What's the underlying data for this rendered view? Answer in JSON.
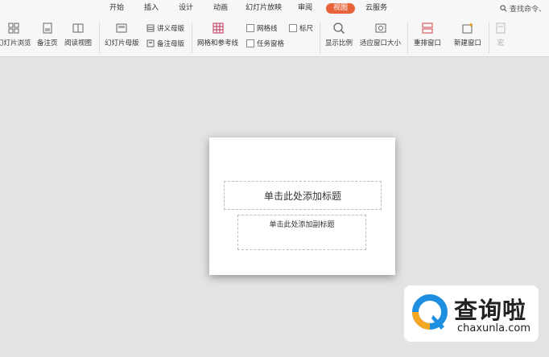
{
  "menu": {
    "tabs": [
      "开始",
      "插入",
      "设计",
      "动画",
      "幻灯片放映",
      "审阅",
      "视图",
      "云服务"
    ],
    "active_tab": "视图",
    "search_label": "查找命令、"
  },
  "ribbon": {
    "slide_browse": "幻灯片浏览",
    "notes_page": "备注页",
    "reading_view": "阅读视图",
    "slide_master": "幻灯片母版",
    "handout_master": "讲义母版",
    "notes_master": "备注母版",
    "grid_guides": "网格和参考线",
    "gridlines": "网格线",
    "ruler": "标尺",
    "task_pane": "任务窗格",
    "zoom": "显示比例",
    "fit_window": "适应窗口大小",
    "arrange_windows": "重排窗口",
    "new_window": "新建窗口",
    "macro": "宏"
  },
  "slide": {
    "title_placeholder": "单击此处添加标题",
    "subtitle_placeholder": "单击此处添加副标题"
  },
  "watermark": {
    "brand": "查询啦",
    "url": "chaxunla.com"
  },
  "colors": {
    "accent": "#e8623a",
    "watermark_blue": "#1e8fe0",
    "watermark_orange": "#f5a623"
  }
}
